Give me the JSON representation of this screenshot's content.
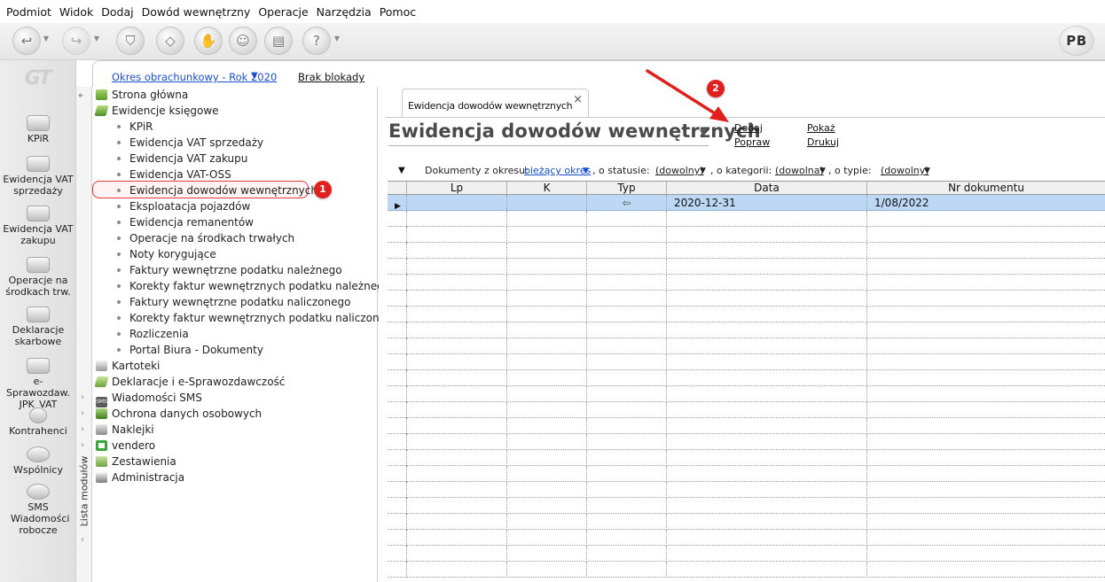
{
  "menu": [
    "Podmiot",
    "Widok",
    "Dodaj",
    "Dowód wewnętrzny",
    "Operacje",
    "Narzędzia",
    "Pomoc"
  ],
  "toolbar": {
    "user_initials": "PB",
    "buttons": [
      "back-icon",
      "forward-icon",
      "stamp-icon",
      "eraser-icon",
      "hand-icon",
      "people-icon",
      "printer-icon",
      "help-icon"
    ]
  },
  "sidebar": {
    "logo": "GT",
    "items": [
      {
        "label": "KPiR"
      },
      {
        "label": "Ewidencja VAT sprzedaży"
      },
      {
        "label": "Ewidencja VAT zakupu"
      },
      {
        "label": "Operacje na środkach trw."
      },
      {
        "label": "Deklaracje skarbowe"
      },
      {
        "label": "e-Sprawozdaw. JPK_VAT"
      },
      {
        "label": "Kontrahenci"
      },
      {
        "label": "Wspólnicy"
      },
      {
        "label": "SMS Wiadomości robocze"
      }
    ]
  },
  "period_bar": {
    "period_label": "Okres obrachunkowy - Rok 2020",
    "lock_label": "Brak blokady"
  },
  "module_list_label": "Lista modułów",
  "tree": {
    "top": [
      {
        "label": "Strona główna",
        "icon": "home-icon"
      },
      {
        "label": "Ewidencje księgowe",
        "icon": "book-icon"
      }
    ],
    "sub": [
      "KPiR",
      "Ewidencja VAT sprzedaży",
      "Ewidencja VAT zakupu",
      "Ewidencja VAT-OSS",
      "Ewidencja dowodów wewnętrznych",
      "Eksploatacja pojazdów",
      "Ewidencja remanentów",
      "Operacje na środkach trwałych",
      "Noty korygujące",
      "Faktury wewnętrzne podatku należnego",
      "Korekty faktur wewnętrznych podatku należnego",
      "Faktury wewnętrzne podatku naliczonego",
      "Korekty faktur wewnętrznych podatku naliczonego",
      "Rozliczenia",
      "Portal Biura - Dokumenty"
    ],
    "bottom": [
      {
        "label": "Kartoteki",
        "icon": "cards-icon"
      },
      {
        "label": "Deklaracje i e-Sprawozdawczość",
        "icon": "declarations-icon"
      },
      {
        "label": "Wiadomości SMS",
        "icon": "sms-icon"
      },
      {
        "label": "Ochrona danych osobowych",
        "icon": "shield-icon"
      },
      {
        "label": "Naklejki",
        "icon": "sticker-icon"
      },
      {
        "label": "vendero",
        "icon": "recycle-icon"
      },
      {
        "label": "Zestawienia",
        "icon": "eye-icon"
      },
      {
        "label": "Administracja",
        "icon": "admin-icon"
      }
    ]
  },
  "callouts": {
    "one": "1",
    "two": "2"
  },
  "document": {
    "tab_label": "Ewidencja dowodów wewnętrznych",
    "tab_close": "×",
    "title": "Ewidencja dowodów wewnętrznych",
    "actions": {
      "add": "Dodaj",
      "edit": "Popraw",
      "show": "Pokaż",
      "print": "Drukuj"
    },
    "filters": {
      "period_prefix": "Dokumenty z okresu:",
      "period_value": "bieżący okres",
      "status_prefix": ", o statusie:",
      "status_value": "(dowolny)",
      "category_prefix": ", o kategorii:",
      "category_value": "(dowolna)",
      "type_prefix": ", o typie:",
      "type_value": "(dowolny)"
    },
    "table": {
      "columns": [
        "Lp",
        "K",
        "Typ",
        "Data",
        "Nr dokumentu"
      ],
      "rows": [
        {
          "lp": "",
          "k": "",
          "typ": "⇦",
          "data": "2020-12-31",
          "nr": "1/08/2022",
          "selected": true
        }
      ],
      "empty_rows": 23
    }
  },
  "colors": {
    "accent_link": "#1a4fd0",
    "selection": "#bcd8f4",
    "annotation_red": "#e0201d"
  }
}
